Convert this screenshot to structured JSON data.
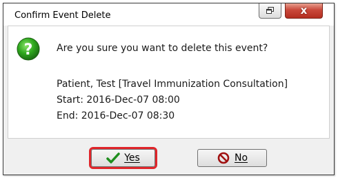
{
  "window": {
    "title": "Confirm Event Delete",
    "close_glyph": "x",
    "icons": {
      "restore": "restore-icon",
      "close": "close-icon"
    }
  },
  "message": {
    "icon": "question-icon",
    "question": "Are you sure you want to delete this event?",
    "line1": "Patient, Test [Travel Immunization Consultation]",
    "line2": "Start: 2016-Dec-07 08:00",
    "line3": "End: 2016-Dec-07 08:30"
  },
  "buttons": {
    "yes": {
      "label": "Yes",
      "icon": "checkmark-icon",
      "icon_color": "#1e8e1e"
    },
    "no": {
      "label": "No",
      "icon": "prohibited-icon",
      "icon_color": "#a01010"
    }
  },
  "highlight": {
    "target": "yes",
    "color": "#e0262b"
  }
}
